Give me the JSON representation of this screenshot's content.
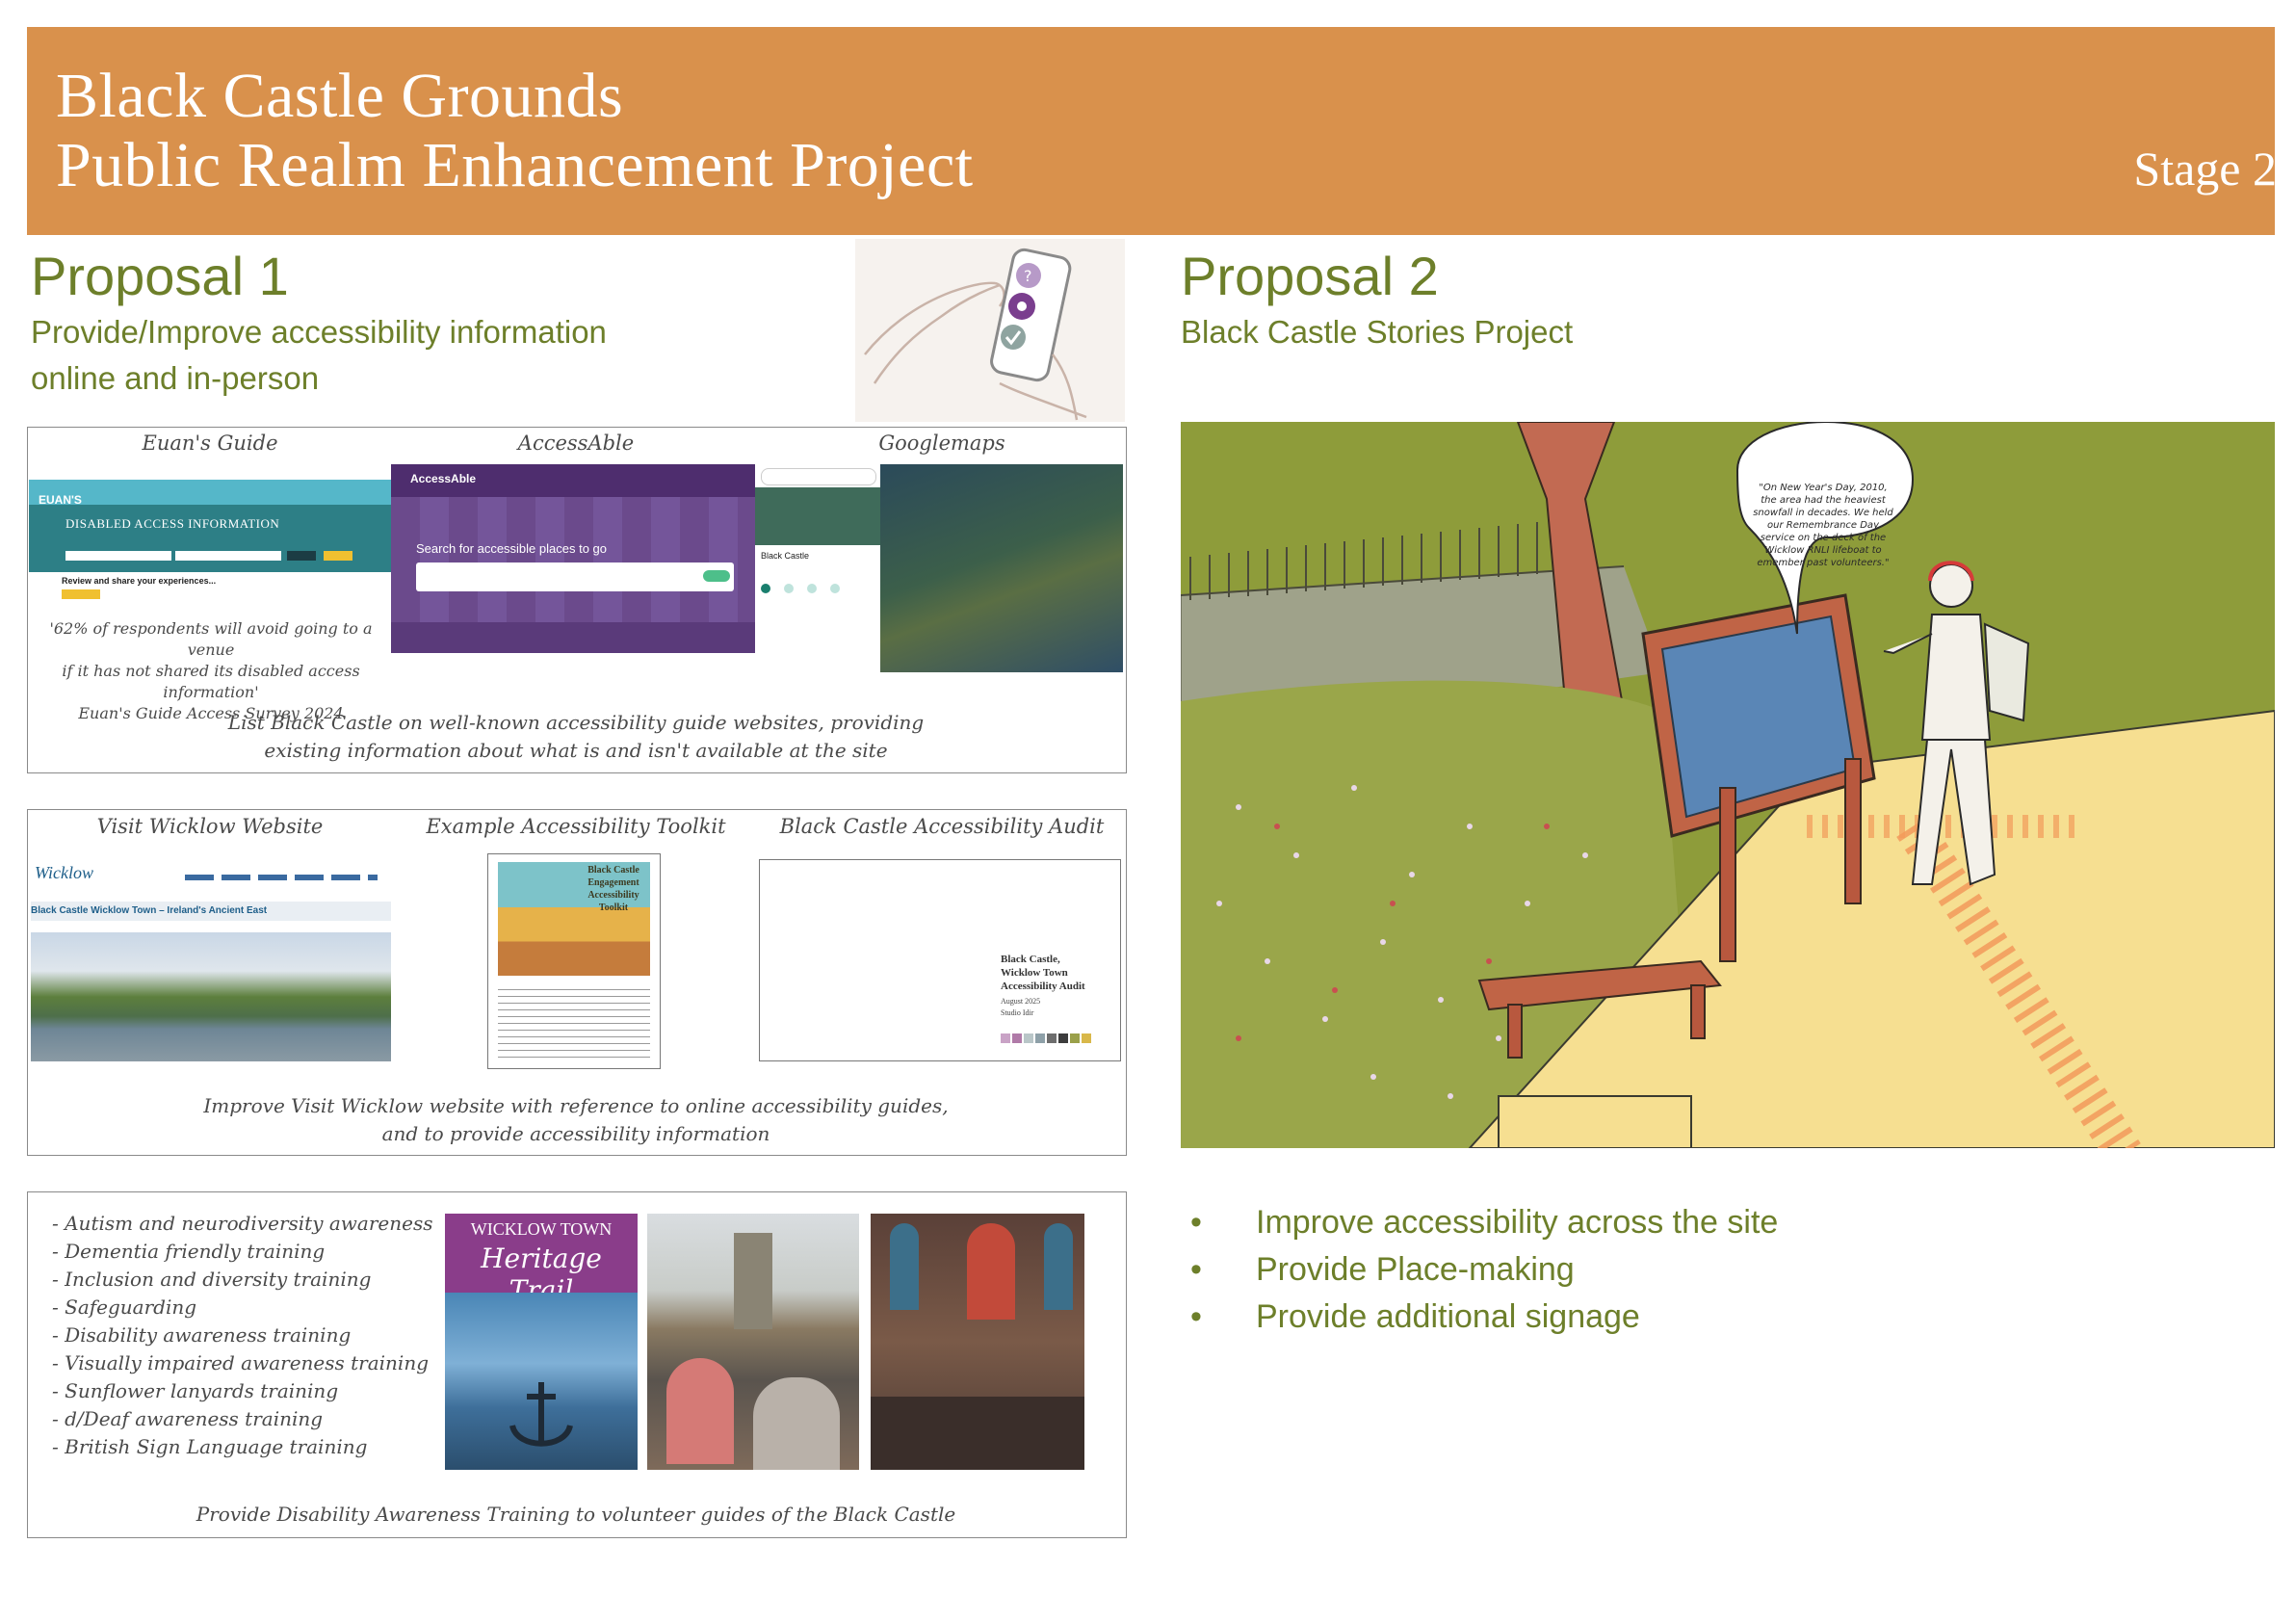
{
  "header": {
    "title_line1": "Black Castle Grounds",
    "title_line2": "Public Realm Enhancement Project",
    "stage": "Stage 2"
  },
  "proposal1": {
    "heading": "Proposal 1",
    "subtitle_line1": "Provide/Improve accessibility information",
    "subtitle_line2": "online and in-person",
    "panel1": {
      "label_euans": "Euan's Guide",
      "label_accessable": "AccessAble",
      "label_googlemaps": "Googlemaps",
      "euans_banner": "Disabled Access Information",
      "euans_logo": "EUAN'S",
      "euans_review": "Review and share your experiences...",
      "accessable_logo": "AccessAble",
      "accessable_search": "Search for accessible places to go",
      "maps_place": "Black Castle",
      "quote_line1": "'62% of respondents will avoid going to a venue",
      "quote_line2": "if it has not shared its disabled access information'",
      "quote_line3": "Euan's Guide Access Survey 2024",
      "caption_line1": "List Black Castle on well-known accessibility guide websites, providing",
      "caption_line2": "existing information about what is and isn't available at the site"
    },
    "panel2": {
      "label_visit": "Visit Wicklow Website",
      "label_toolkit": "Example Accessibility Toolkit",
      "label_audit": "Black Castle Accessibility Audit",
      "wicklow_logo": "Wicklow",
      "wicklow_page_title": "Black Castle Wicklow Town – Ireland's Ancient East",
      "toolkit_title_line1": "Black Castle",
      "toolkit_title_line2": "Engagement",
      "toolkit_title_line3": "Accessibility",
      "toolkit_title_line4": "Toolkit",
      "audit_line1": "Black Castle,",
      "audit_line2": "Wicklow Town",
      "audit_line3": "Accessibility Audit",
      "audit_date": "August 2025",
      "audit_author": "Studio Idir",
      "audit_swatches": [
        "#c9a3c6",
        "#b07aa8",
        "#b9c6c8",
        "#8ea0a8",
        "#6d6d6d",
        "#3d3d3d",
        "#9aa04a",
        "#d9b84a"
      ],
      "caption_line1": "Improve Visit Wicklow website with reference to online accessibility guides,",
      "caption_line2": "and to provide accessibility information"
    },
    "panel3": {
      "trainings": [
        "- Autism and neurodiversity awareness",
        "- Dementia friendly training",
        "- Inclusion and diversity training",
        "- Safeguarding",
        "- Disability awareness training",
        "- Visually impaired awareness training",
        "- Sunflower lanyards training",
        "- d/Deaf awareness training",
        "- British Sign Language training"
      ],
      "booklet_line1": "WICKLOW TOWN",
      "booklet_line2": "Heritage Trail",
      "caption": "Provide Disability Awareness Training to volunteer guides of the Black Castle"
    }
  },
  "proposal2": {
    "heading": "Proposal 2",
    "subtitle": "Black Castle Stories Project",
    "speech": "\"On New Year's Day, 2010, the area had the heaviest snowfall in decades. We held our Remembrance Day service on the deck of the Wicklow RNLI lifeboat to emember past volunteers.\"",
    "bullets": [
      "Improve accessibility across the site",
      "Provide Place-making",
      "Provide additional signage"
    ]
  },
  "colors": {
    "header": "#d9914c",
    "accent_green": "#6d7f2a",
    "grass": "#8e9c3a",
    "path": "#f6df91"
  },
  "icons": [
    "phone-hand-illustration",
    "question-bubble-icon",
    "settings-icon",
    "check-icon"
  ]
}
